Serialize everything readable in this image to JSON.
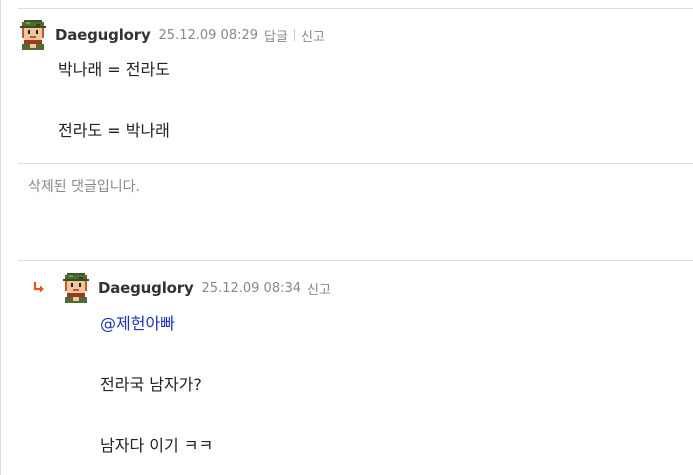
{
  "comments": [
    {
      "author": "Daeguglory",
      "date": "25.12.09 08:29",
      "reply_label": "답글",
      "report_label": "신고",
      "lines": [
        "박나래 = 전라도",
        "전라도 = 박나래"
      ]
    },
    {
      "deleted_text": "삭제된 댓글입니다."
    },
    {
      "author": "Daeguglory",
      "date": "25.12.09 08:34",
      "report_label": "신고",
      "mention": "@제헌아빠",
      "lines": [
        "전라국 남자가?",
        "남자다 이기 ㅋㅋ"
      ]
    }
  ],
  "colors": {
    "mention": "#1a33b8",
    "reply_arrow": "#e8541f",
    "meta_text": "#888888"
  },
  "icons": {
    "avatar": "pixel-soldier-avatar-icon",
    "reply": "reply-arrow-icon"
  }
}
